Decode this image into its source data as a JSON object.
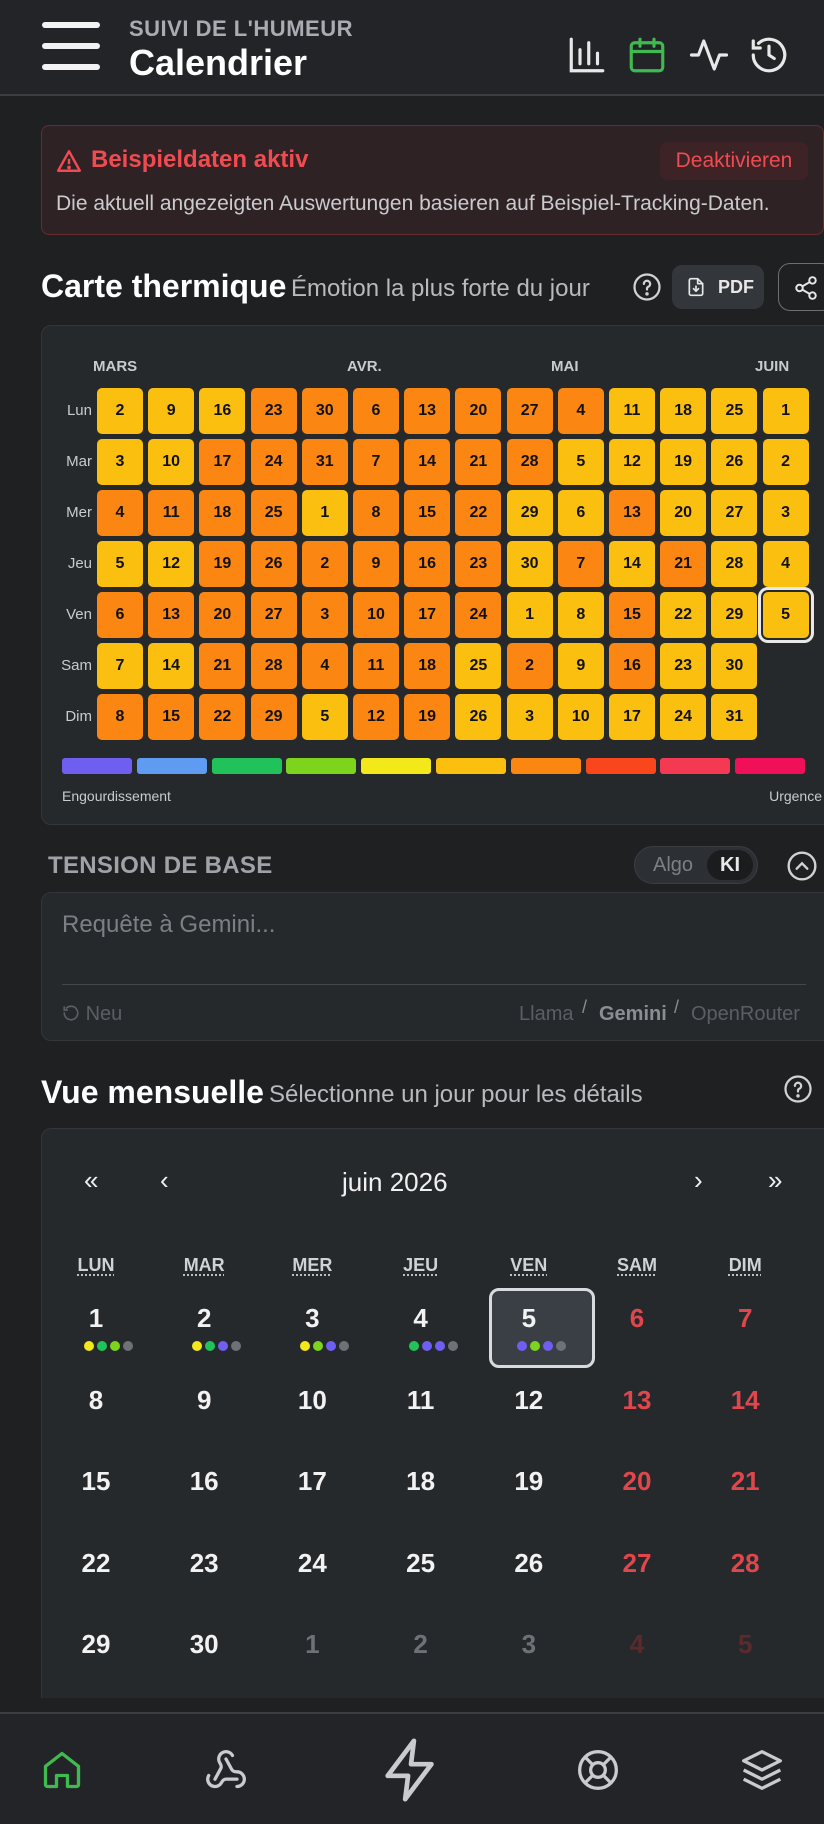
{
  "header": {
    "subtitle": "SUIVI DE L'HUMEUR",
    "title": "Calendrier",
    "icons": [
      "menu-icon",
      "bar-chart-icon",
      "calendar-icon",
      "activity-icon",
      "history-icon"
    ],
    "active_color": "#3fb950"
  },
  "alert": {
    "title": "Beispieldaten aktiv",
    "button": "Deaktivieren",
    "text": "Die aktuell angezeigten Auswertungen basieren auf Beispiel-Tracking-Daten.",
    "color": "#ef4b50"
  },
  "heatmap": {
    "title": "Carte thermique",
    "subtitle": "Émotion la plus forte du jour",
    "pdf_label": "PDF",
    "months": [
      "MARS",
      "AVR.",
      "MAI",
      "JUIN"
    ],
    "weekdays": [
      "Lun",
      "Mar",
      "Mer",
      "Jeu",
      "Ven",
      "Sam",
      "Dim"
    ],
    "legend_left": "Engourdissement",
    "legend_right": "Urgence",
    "scale_colors": [
      "#6e5ff0",
      "#5f9bf0",
      "#22c25a",
      "#7dd41c",
      "#f3e81a",
      "#fbbf0f",
      "#fb8612",
      "#f9461c",
      "#f43a52",
      "#f0105a"
    ],
    "weeks": [
      [
        "2",
        "3",
        "4",
        "5",
        "6",
        "7",
        "8"
      ],
      [
        "9",
        "10",
        "11",
        "12",
        "13",
        "14",
        "15"
      ],
      [
        "16",
        "17",
        "18",
        "19",
        "20",
        "21",
        "22"
      ],
      [
        "23",
        "24",
        "25",
        "26",
        "27",
        "28",
        "29"
      ],
      [
        "30",
        "31",
        "1",
        "2",
        "3",
        "4",
        "5"
      ],
      [
        "6",
        "7",
        "8",
        "9",
        "10",
        "11",
        "12"
      ],
      [
        "13",
        "14",
        "15",
        "16",
        "17",
        "18",
        "19"
      ],
      [
        "20",
        "21",
        "22",
        "23",
        "24",
        "25",
        "26"
      ],
      [
        "27",
        "28",
        "29",
        "30",
        "1",
        "2",
        "3"
      ],
      [
        "4",
        "5",
        "6",
        "7",
        "8",
        "9",
        "10"
      ],
      [
        "11",
        "12",
        "13",
        "14",
        "15",
        "16",
        "17"
      ],
      [
        "18",
        "19",
        "20",
        "21",
        "22",
        "23",
        "24"
      ],
      [
        "25",
        "26",
        "27",
        "28",
        "29",
        "30",
        "31"
      ],
      [
        "1",
        "2",
        "3",
        "4",
        "5",
        "",
        ""
      ]
    ],
    "levels": [
      [
        "y",
        "y",
        "o",
        "y",
        "o",
        "y",
        "o"
      ],
      [
        "y",
        "y",
        "o",
        "y",
        "o",
        "y",
        "o"
      ],
      [
        "y",
        "o",
        "o",
        "o",
        "o",
        "o",
        "o"
      ],
      [
        "o",
        "o",
        "o",
        "o",
        "o",
        "o",
        "o"
      ],
      [
        "o",
        "o",
        "y",
        "o",
        "o",
        "o",
        "y"
      ],
      [
        "o",
        "o",
        "o",
        "o",
        "o",
        "o",
        "o"
      ],
      [
        "o",
        "o",
        "o",
        "o",
        "o",
        "o",
        "o"
      ],
      [
        "o",
        "o",
        "o",
        "o",
        "o",
        "y",
        "y"
      ],
      [
        "o",
        "o",
        "y",
        "y",
        "y",
        "o",
        "y"
      ],
      [
        "o",
        "y",
        "y",
        "o",
        "y",
        "y",
        "y"
      ],
      [
        "y",
        "y",
        "o",
        "y",
        "o",
        "o",
        "y"
      ],
      [
        "y",
        "y",
        "y",
        "o",
        "y",
        "y",
        "y"
      ],
      [
        "y",
        "y",
        "y",
        "y",
        "y",
        "y",
        "y"
      ],
      [
        "y",
        "y",
        "y",
        "y",
        "y",
        "",
        ""
      ]
    ],
    "selected": "5"
  },
  "tension": {
    "title": "TENSION DE BASE",
    "toggle_algo": "Algo",
    "toggle_ki": "KI",
    "placeholder": "Requête à Gemini...",
    "reset": "Neu",
    "providers": [
      "Llama",
      "Gemini",
      "OpenRouter"
    ],
    "active_provider": "Gemini"
  },
  "calendar": {
    "title": "Vue mensuelle",
    "subtitle": "Sélectionne un jour pour les détails",
    "month": "juin 2026",
    "nav": [
      "«",
      "‹",
      "›",
      "»"
    ],
    "weekdays": [
      "LUN",
      "MAR",
      "MER",
      "JEU",
      "VEN",
      "SAM",
      "DIM"
    ],
    "rows": [
      [
        "1",
        "2",
        "3",
        "4",
        "5",
        "6",
        "7"
      ],
      [
        "8",
        "9",
        "10",
        "11",
        "12",
        "13",
        "14"
      ],
      [
        "15",
        "16",
        "17",
        "18",
        "19",
        "20",
        "21"
      ],
      [
        "22",
        "23",
        "24",
        "25",
        "26",
        "27",
        "28"
      ],
      [
        "29",
        "30",
        "1",
        "2",
        "3",
        "4",
        "5"
      ]
    ],
    "selected": "5",
    "day_dots": {
      "1": [
        "#f3e81a",
        "#22c25a",
        "#7dd41c",
        "#6e7277"
      ],
      "2": [
        "#f3e81a",
        "#22c25a",
        "#6e5ff0",
        "#6e7277"
      ],
      "3": [
        "#f3e81a",
        "#7dd41c",
        "#6e5ff0",
        "#6e7277"
      ],
      "4": [
        "#22c25a",
        "#6e5ff0",
        "#6e5ff0",
        "#6e7277"
      ],
      "5": [
        "#6e5ff0",
        "#7dd41c",
        "#6e5ff0",
        "#6e7277"
      ]
    }
  },
  "bottom_nav": [
    "home-icon",
    "webhook-icon",
    "bolt-icon",
    "lifebuoy-icon",
    "layers-icon"
  ]
}
